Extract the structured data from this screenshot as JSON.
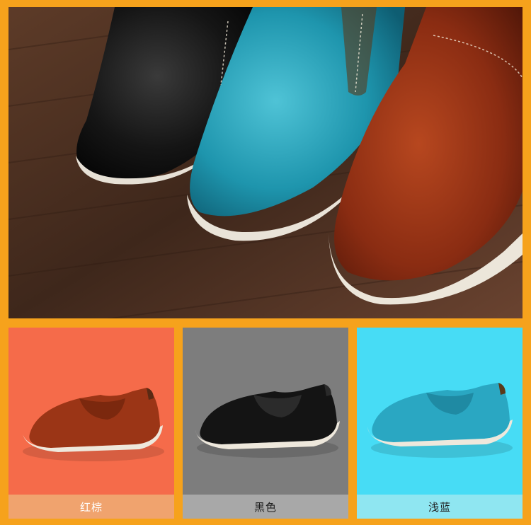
{
  "colors": {
    "border": "#f6a21c",
    "red_brown_panel": "#f56b4a",
    "black_panel": "#7d7d7d",
    "light_blue_panel": "#47dcf5"
  },
  "variants": [
    {
      "label": "红棕"
    },
    {
      "label": "黑色"
    },
    {
      "label": "浅蓝"
    }
  ]
}
